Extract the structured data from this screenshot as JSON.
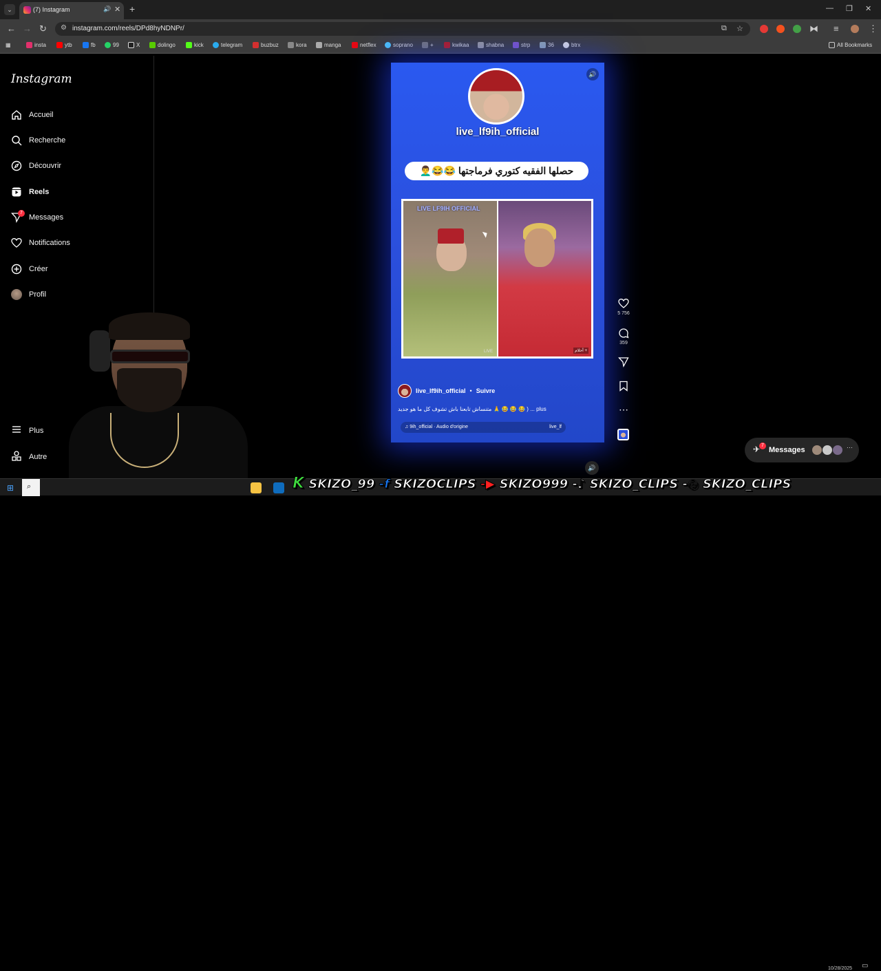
{
  "browser": {
    "tab_title": "(7) Instagram",
    "url": "instagram.com/reels/DPd8hyNDNPr/",
    "bookmarks": [
      {
        "label": "insta",
        "color": "#e1306c"
      },
      {
        "label": "ytb",
        "color": "#ff0000"
      },
      {
        "label": "fb",
        "color": "#1877f2"
      },
      {
        "label": "99",
        "color": "#25d366"
      },
      {
        "label": "X",
        "color": "#ffffff"
      },
      {
        "label": "dolingo",
        "color": "#58cc02"
      },
      {
        "label": "kick",
        "color": "#53fc18"
      },
      {
        "label": "telegram",
        "color": "#2aabee"
      },
      {
        "label": "buzbuz",
        "color": "#d32f2f"
      },
      {
        "label": "kora",
        "color": "#888888"
      },
      {
        "label": "manga",
        "color": "#aaaaaa"
      },
      {
        "label": "netflex",
        "color": "#e50914"
      },
      {
        "label": "soprano",
        "color": "#4fc3f7"
      },
      {
        "label": "+",
        "color": "#777777"
      },
      {
        "label": "kwikaa",
        "color": "#b71c1c"
      },
      {
        "label": "shabna",
        "color": "#999999"
      },
      {
        "label": "strp",
        "color": "#7e57c2"
      },
      {
        "label": "36",
        "color": "#90a4ae"
      },
      {
        "label": "btrx",
        "color": "#dddddd"
      }
    ],
    "all_bookmarks": "All Bookmarks"
  },
  "sidebar": {
    "logo": "Instagram",
    "items": [
      {
        "label": "Accueil",
        "icon": "home-icon"
      },
      {
        "label": "Recherche",
        "icon": "search-icon"
      },
      {
        "label": "Découvrir",
        "icon": "compass-icon"
      },
      {
        "label": "Reels",
        "icon": "reels-icon"
      },
      {
        "label": "Messages",
        "icon": "messenger-icon",
        "badge": "7"
      },
      {
        "label": "Notifications",
        "icon": "heart-icon"
      },
      {
        "label": "Créer",
        "icon": "plus-square-icon"
      },
      {
        "label": "Profil",
        "icon": "avatar-icon"
      }
    ],
    "more": "Plus",
    "other": "Autre"
  },
  "reel": {
    "overlay_handle": "live_lf9ih_official",
    "overlay_caption_ar": "حصلها الفقيه كتوري فرماجتها 😂😂👨‍🦱",
    "video_watermark": "LIVE LF9IH OFFICIAL",
    "video_corner_left": "LIVE",
    "video_corner_right": "أحلام +",
    "author": "live_lf9ih_official",
    "separator": "•",
    "follow": "Suivre",
    "caption": "متنساش تابعنا باش تشوف كل ما هو جديد 🙏 😂 😂 😂 ) ... plus",
    "audio_left": "♫ 9ih_official · Audio d'origine",
    "audio_right": "live_lf",
    "likes": "5 756",
    "comments": "359"
  },
  "messages_pill": {
    "label": "Messages",
    "badge": "7"
  },
  "overlay_banner": {
    "kick": "SKIZO_99",
    "facebook": "SKIZOCLIPS",
    "youtube": "SKIZO999",
    "tiktok": "SKIZO_CLIPS",
    "instagram": "SKIZO_CLIPS"
  },
  "taskbar": {
    "date": "10/28/2025"
  }
}
